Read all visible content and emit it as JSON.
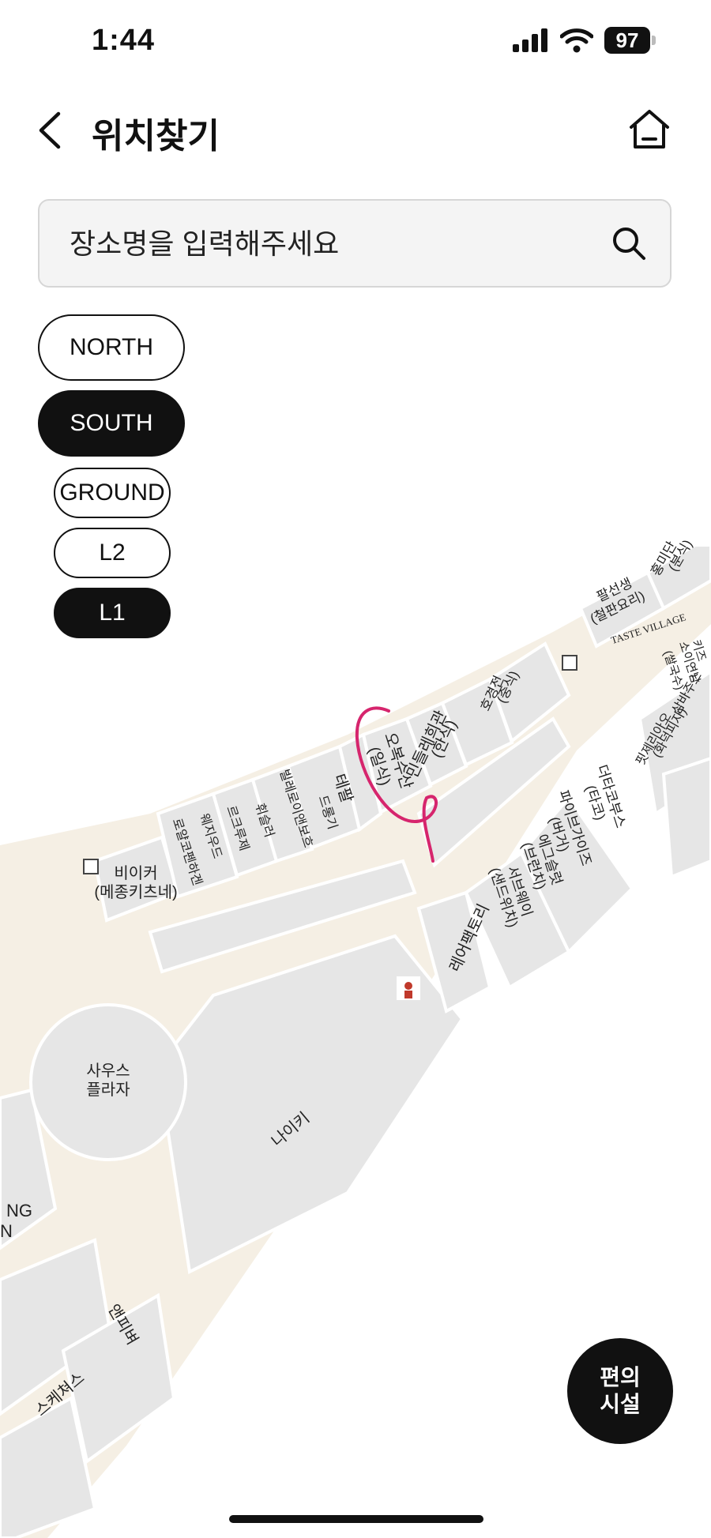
{
  "status_bar": {
    "time": "1:44",
    "battery": "97"
  },
  "header": {
    "title": "위치찾기"
  },
  "search": {
    "placeholder": "장소명을 입력해주세요"
  },
  "zones": [
    {
      "label": "NORTH",
      "active": false
    },
    {
      "label": "SOUTH",
      "active": true
    }
  ],
  "floors": [
    {
      "label": "GROUND",
      "active": false
    },
    {
      "label": "L2",
      "active": false
    },
    {
      "label": "L1",
      "active": true
    }
  ],
  "map": {
    "plaza": [
      "사우스",
      "플라자"
    ],
    "taste_village": "TASTE VILLAGE",
    "stores": {
      "beaker": [
        "비이커",
        "(메종키츠네)"
      ],
      "nike": "나이키",
      "layer_factory": "레어팩토리",
      "ohbok": [
        "오복수산",
        "(일식)"
      ],
      "mindle": [
        "민들레희관",
        "(한식)"
      ],
      "hogyeongjeon": [
        "호경전",
        "(중식)"
      ],
      "palseonsaeng": [
        "팔선생",
        "(철판요리)"
      ],
      "hongmidan": [
        "홍미단",
        "(분식)"
      ],
      "tiffany_cafe": "테팔",
      "dragon": "드롱기",
      "villeroy": "빌레로이앤보흐",
      "wmf": "휘슬러",
      "lecreuset": "르크루제",
      "wedgwood": "웨지우드",
      "royal_copenhagen": "로얄코펜하겐",
      "pizza": [
        "핏제리아오",
        "(화덕피자)"
      ],
      "sambaju": "삼바주스",
      "kids": [
        "키즈",
        "소이연남",
        "(쌀국수)"
      ],
      "terrace_boss": [
        "더타코부스",
        "(타코)"
      ],
      "fried_chicken": [
        "파이브가이즈",
        "(버거)"
      ],
      "shake_shack": [
        "에그슬럿",
        "(브런치)"
      ],
      "subway": [
        "서브웨이",
        "(샌드위치)"
      ],
      "kayeon": "앤피벼",
      "skechers": "스케쳐스",
      "partial_left": [
        "NG",
        "N"
      ]
    }
  },
  "facilities_button": {
    "line1": "편의",
    "line2": "시설"
  },
  "colors": {
    "walkway": "#f5efe4",
    "store": "#e6e6e6",
    "store_border": "#ffffff",
    "annotation": "#d6256d"
  }
}
